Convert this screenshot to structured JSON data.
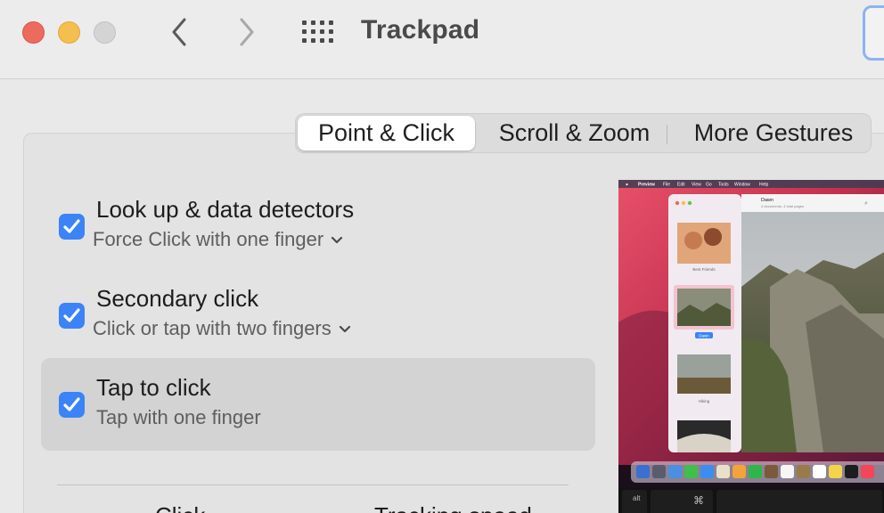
{
  "window": {
    "title": "Trackpad"
  },
  "tabs": [
    {
      "label": "Point & Click",
      "active": true
    },
    {
      "label": "Scroll & Zoom",
      "active": false
    },
    {
      "label": "More Gestures",
      "active": false
    }
  ],
  "options": [
    {
      "title": "Look up & data detectors",
      "subtitle": "Force Click with one finger",
      "checked": true,
      "has_dropdown": true
    },
    {
      "title": "Secondary click",
      "subtitle": "Click or tap with two fingers",
      "checked": true,
      "has_dropdown": true
    },
    {
      "title": "Tap to click",
      "subtitle": "Tap with one finger",
      "checked": true,
      "has_dropdown": false
    }
  ],
  "bottom": {
    "left_label": "Click",
    "right_label": "Tracking speed"
  },
  "preview": {
    "menubar": [
      "Preview",
      "File",
      "Edit",
      "View",
      "Go",
      "Tools",
      "Window",
      "Help"
    ],
    "document_title": "Dawn",
    "document_subtitle": "4 documents, 4 total pages",
    "thumbnails": [
      "Best Friends",
      "Dawn",
      "Hiking",
      ""
    ],
    "keyboard": {
      "key1": "alt",
      "key2": "⌘"
    }
  },
  "colors": {
    "accent": "#3b83f7",
    "close": "#ed6a5e",
    "minimize": "#f5bf4f",
    "zoom_disabled": "#d4d4d4",
    "selected_row": "#d3d3d3"
  },
  "icons": {
    "back": "chevron-left-icon",
    "forward": "chevron-right-icon",
    "show_all": "grid-icon",
    "dropdown": "chevron-down-icon",
    "check": "checkmark-icon"
  }
}
